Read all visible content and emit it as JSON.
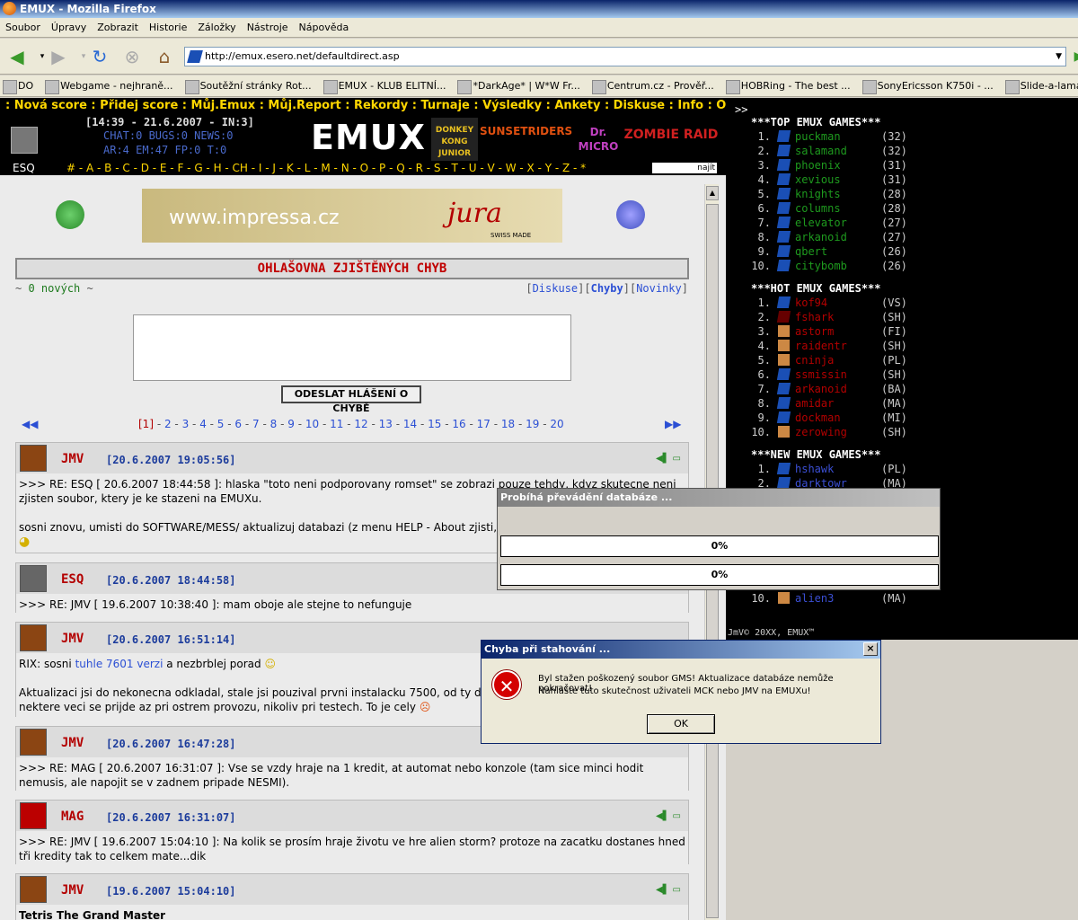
{
  "window": {
    "title": "EMUX - Mozilla Firefox"
  },
  "menu": [
    "Soubor",
    "Úpravy",
    "Zobrazit",
    "Historie",
    "Záložky",
    "Nástroje",
    "Nápověda"
  ],
  "url": "http://emux.esero.net/defaultdirect.asp",
  "bookmarks": [
    "DO",
    "Webgame - nejhraně...",
    "Soutěžní stránky Rot...",
    "EMUX - KLUB ELITNÍ...",
    "*DarkAge* | W*W Fr...",
    "Centrum.cz - Prověř...",
    "HOBRing - The best ...",
    "SonyEricsson K750i - ...",
    "Slide-a-lama CZ - Ke ..."
  ],
  "site": {
    "topnav": ": Nová score : Přidej score : Můj.Emux : Můj.Report : Rekordy : Turnaje : Výsledky : Ankety : Diskuse : Info : Odhlášení :",
    "clock": "[14:39 - 21.6.2007 - IN:3]",
    "stats1": "CHAT:0 BUGS:0 NEWS:0",
    "stats2": "AR:4 EM:47 FP:0 T:0",
    "logo": "EMUX",
    "games": [
      "DONKEY KONG JUNIOR",
      "SUNSETRIDERS",
      "Dr. MICRO",
      "ZOMBIE RAID"
    ],
    "esq": "ESQ",
    "alphabet": "# - A - B - C - D - E - F - G - H - CH - I - J - K - L - M - N - O - P - Q - R - S - T - U - V - W - X - Y - Z - *",
    "search": "najít",
    "banner": {
      "url": "www.impressa.cz",
      "brand": "jura",
      "sub": "SWISS MADE"
    },
    "heading": "OHLAŠOVNA ZJIŠTĚNÝCH CHYB",
    "novych_pre": "~",
    "novych": "0 nových",
    "novych_post": "~",
    "links": {
      "diskuse": "Diskuse",
      "chyby": "Chyby",
      "novinky": "Novinky"
    },
    "send_button": "ODESLAT HLÁŠENÍ O CHYBĚ",
    "pager_current": "[1]",
    "pager_pages": [
      "2",
      "3",
      "4",
      "5",
      "6",
      "7",
      "8",
      "9",
      "10",
      "11",
      "12",
      "13",
      "14",
      "15",
      "16",
      "17",
      "18",
      "19",
      "20"
    ],
    "posts": [
      {
        "nick": "JMV",
        "date": "[20.6.2007 19:05:56]",
        "lines": [
          ">>> RE: ESQ [ 20.6.2007 18:44:58 ]: hlaska \"toto neni podporovany romset\" se zobrazi pouze tehdy, kdyz skutecne neni zjisten soubor, ktery je ke stazeni na EMUXu.",
          "sosni znovu, umisti do SOFTWARE/MESS/ aktualizuj databazi (z menu HELP - About zjisti, zda"
        ]
      },
      {
        "nick": "ESQ",
        "date": "[20.6.2007 18:44:58]",
        "lines": [
          ">>> RE: JMV [ 19.6.2007 10:38:40 ]: mam oboje ale stejne to nefunguje"
        ]
      },
      {
        "nick": "JMV",
        "date": "[20.6.2007 16:51:14]",
        "pre": "RIX: sosni",
        "link": "tuhle 7601 verzi",
        "post": "a nezbrblej porad",
        "lines": [
          "Aktualizaci jsi do nekonecna odkladal, stale jsi pouzival prvni instalacku 7500, od ty doby js",
          "nektere veci se prijde az pri ostrem provozu, nikoliv pri testech. To je cely"
        ]
      },
      {
        "nick": "JMV",
        "date": "[20.6.2007 16:47:28]",
        "lines": [
          ">>> RE: MAG [ 20.6.2007 16:31:07 ]: Vse se vzdy hraje na 1 kredit, at automat nebo konzole (tam sice minci hodit nemusis, ale napojit se v zadnem pripade NESMI)."
        ]
      },
      {
        "nick": "MAG",
        "date": "[20.6.2007 16:31:07]",
        "lines": [
          ">>> RE: JMV [ 19.6.2007 15:04:10 ]: Na kolik se prosím hraje životu ve hre alien storm? protoze na zacatku dostanes hned tři kredity tak to celkem mate...dik"
        ]
      },
      {
        "nick": "JMV",
        "date": "[19.6.2007 15:04:10]",
        "lines": [
          "Tetris The Grand Master"
        ]
      }
    ]
  },
  "right": {
    "prompt": ">>",
    "top_title": "***TOP EMUX GAMES***",
    "top": [
      [
        "1.",
        "puckman",
        "(32)"
      ],
      [
        "2.",
        "salamand",
        "(32)"
      ],
      [
        "3.",
        "phoenix",
        "(31)"
      ],
      [
        "4.",
        "xevious",
        "(31)"
      ],
      [
        "5.",
        "knights",
        "(28)"
      ],
      [
        "6.",
        "columns",
        "(28)"
      ],
      [
        "7.",
        "elevator",
        "(27)"
      ],
      [
        "8.",
        "arkanoid",
        "(27)"
      ],
      [
        "9.",
        "qbert",
        "(26)"
      ],
      [
        "10.",
        "citybomb",
        "(26)"
      ]
    ],
    "hot_title": "***HOT EMUX GAMES***",
    "hot": [
      [
        "1.",
        "kof94",
        "(VS)"
      ],
      [
        "2.",
        "fshark",
        "(SH)"
      ],
      [
        "3.",
        "astorm",
        "(FI)"
      ],
      [
        "4.",
        "raidentr",
        "(SH)"
      ],
      [
        "5.",
        "cninja",
        "(PL)"
      ],
      [
        "6.",
        "ssmissin",
        "(SH)"
      ],
      [
        "7.",
        "arkanoid",
        "(BA)"
      ],
      [
        "8.",
        "amidar",
        "(MA)"
      ],
      [
        "9.",
        "dockman",
        "(MI)"
      ],
      [
        "10.",
        "zerowing",
        "(SH)"
      ]
    ],
    "new_title": "***NEW EMUX GAMES***",
    "new": [
      [
        "1.",
        "hshawk",
        "(PL)"
      ],
      [
        "2.",
        "darktowr",
        "(MA)"
      ]
    ],
    "new_last": [
      "10.",
      "alien3",
      "(MA)"
    ],
    "footer": "JmV© 20XX, EMUX™"
  },
  "progress_dialog": {
    "title": "Probíhá převádění databáze ...",
    "bar1": "0%",
    "bar2": "0%",
    "bar1_value": 0,
    "bar2_value": 0
  },
  "error_dialog": {
    "title": "Chyba při stahování ...",
    "line1": "Byl stažen poškozený soubor GMS! Aktualizace databáze nemůže pokračovat!",
    "line2": "Nahlašte tuto skutečnost uživateli MCK nebo JMV na EMUXu!",
    "ok": "OK",
    "close": "×"
  }
}
